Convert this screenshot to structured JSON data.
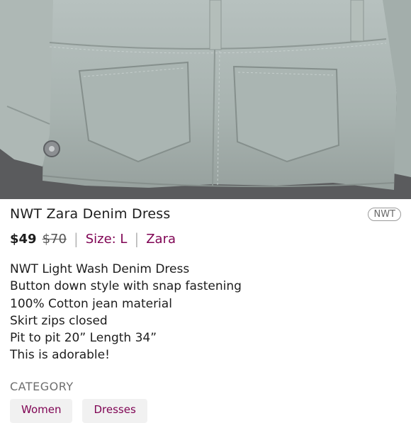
{
  "listing": {
    "photo_alt": "light wash denim dress back pockets",
    "title": "NWT Zara Denim Dress",
    "badge": "NWT",
    "price": "$49",
    "original_price": "$70",
    "size": "Size: L",
    "brand": "Zara",
    "separator": "|",
    "description": [
      "NWT Light Wash Denim Dress",
      "Button down style with snap fastening",
      "100% Cotton jean material",
      "Skirt zips closed",
      "Pit to pit 20” Length 34”",
      "This is adorable!"
    ],
    "category_heading": "CATEGORY",
    "categories": [
      "Women",
      "Dresses"
    ]
  },
  "colors": {
    "accent": "#7f0353",
    "denim": "#a9b4b0",
    "chip_bg": "#f1f1f1"
  }
}
